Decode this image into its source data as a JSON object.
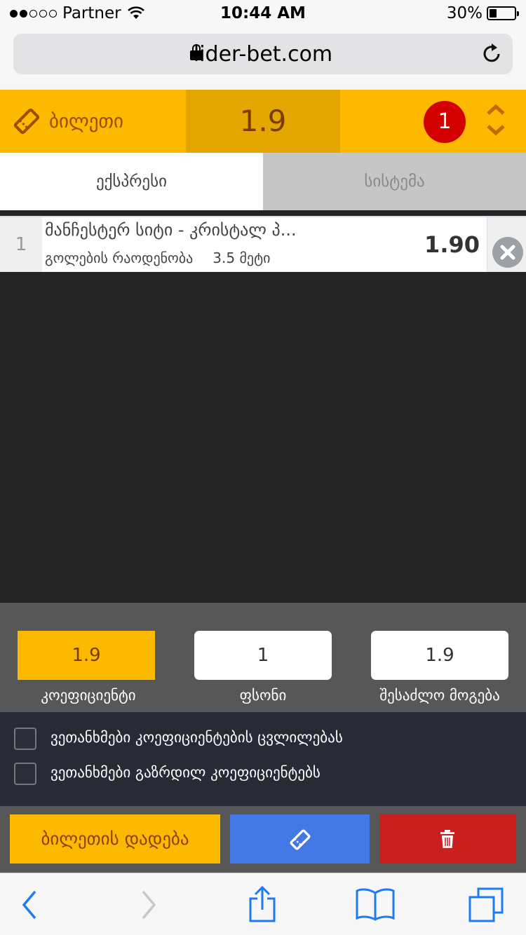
{
  "status_bar": {
    "carrier": "Partner",
    "time": "10:44 AM",
    "battery": "30%",
    "battery_level": 0.3
  },
  "browser": {
    "domain": "lider-bet.com"
  },
  "ticket_header": {
    "label": "ბილეთი",
    "total_odds": "1.9",
    "count": "1"
  },
  "tabs": [
    {
      "label": "ექსპრესი",
      "active": true
    },
    {
      "label": "სისტემა",
      "active": false
    }
  ],
  "bet": {
    "index": "1",
    "teams": "მანჩესტერ სიტი - კრისტალ პ...",
    "market": "გოლების რაოდენობა",
    "selection": "3.5 მეტი",
    "odds": "1.90"
  },
  "summary": {
    "coefficient_value": "1.9",
    "coefficient_label": "კოეფიციენტი",
    "stake_value": "1",
    "stake_label": "ფსონი",
    "win_value": "1.9",
    "win_label": "შესაძლო მოგება"
  },
  "agreements": [
    {
      "label": "ვეთანხმები კოეფიციენტების ცვლილებას",
      "checked": false
    },
    {
      "label": "ვეთანხმები გაზრდილ კოეფიციენტებს",
      "checked": false
    }
  ],
  "actions": {
    "place_label": "ბილეთის დადება"
  },
  "colors": {
    "accent": "#fdb800",
    "blue": "#4378e6",
    "red": "#c91f1f",
    "badge": "#d40000",
    "safari_blue": "#1e7cf2"
  },
  "icons": [
    "wifi-icon",
    "lock-icon",
    "reload-icon",
    "ticket-icon",
    "up-down-icon",
    "close-icon",
    "trash-icon",
    "back-icon",
    "forward-icon",
    "share-icon",
    "bookmarks-icon",
    "tabs-icon"
  ]
}
